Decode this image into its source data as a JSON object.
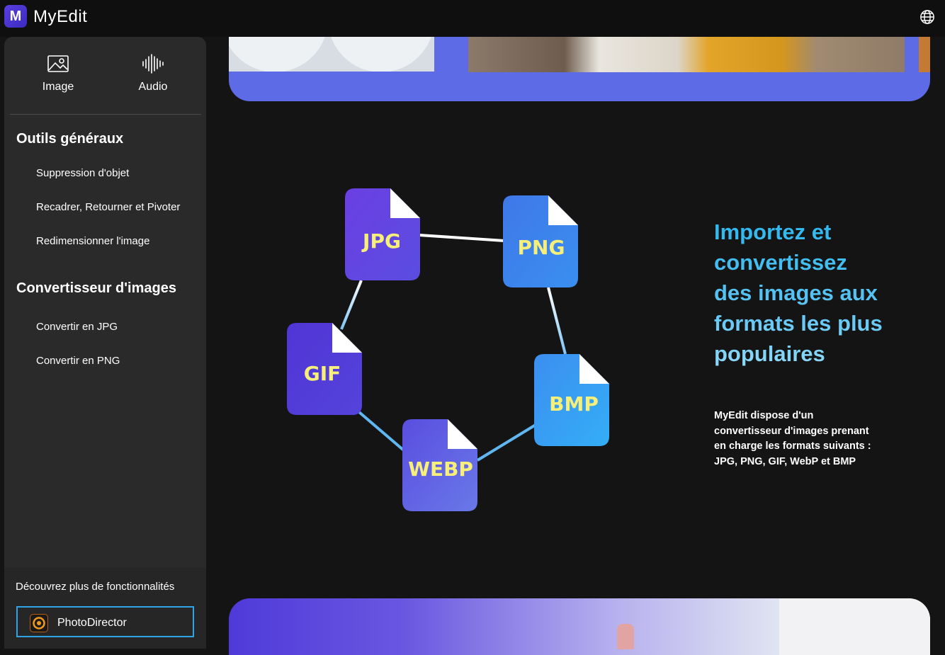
{
  "app": {
    "name": "MyEdit",
    "logo_letter": "M"
  },
  "sidebar": {
    "categories": [
      {
        "label": "Image",
        "icon": "image-icon"
      },
      {
        "label": "Audio",
        "icon": "audio-waveform-icon"
      }
    ],
    "sections": [
      {
        "title": "Outils généraux",
        "items": [
          "Suppression d'objet",
          "Recadrer, Retourner et Pivoter",
          "Redimensionner l'image"
        ]
      },
      {
        "title": "Convertisseur d'images",
        "items": [
          "Convertir en JPG",
          "Convertir en PNG"
        ]
      }
    ],
    "footer": {
      "text": "Découvrez plus de fonctionnalités",
      "button_label": "PhotoDirector"
    }
  },
  "diagram": {
    "formats": [
      "JPG",
      "PNG",
      "BMP",
      "WEBP",
      "GIF"
    ]
  },
  "content": {
    "headline": "Importez et convertissez des images aux formats les plus populaires",
    "description": "MyEdit dispose d'un convertisseur d'images prenant en charge les formats suivants : JPG, PNG, GIF, WebP et BMP"
  },
  "colors": {
    "accent": "#5b3fe0",
    "headline_gradient": [
      "#2bb7ee",
      "#8fd9f8"
    ],
    "file_label": "#f6ef7a",
    "border_highlight": "#2ea3e6"
  }
}
